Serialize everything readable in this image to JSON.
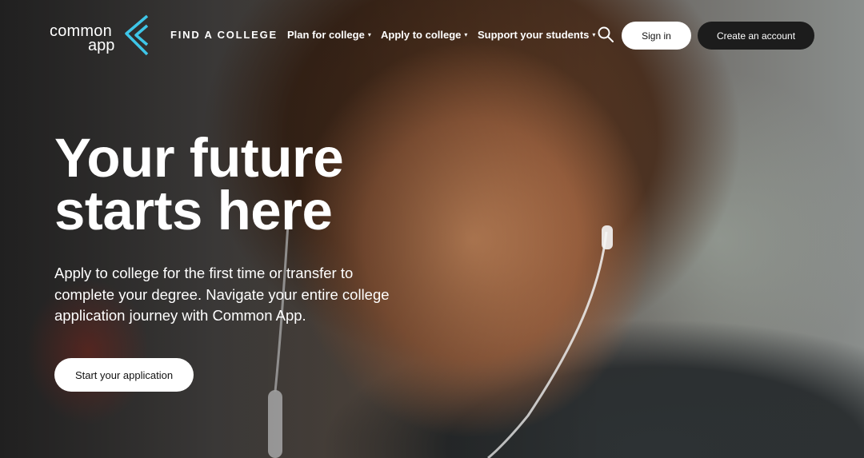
{
  "logo": {
    "line1": "common",
    "line2": "app",
    "accent": "#3ec6e8"
  },
  "nav": {
    "find": "FIND A COLLEGE",
    "items": [
      {
        "label": "Plan for college"
      },
      {
        "label": "Apply to college"
      },
      {
        "label": "Support your students"
      }
    ],
    "caret": "▾",
    "search_icon": "search-icon"
  },
  "auth": {
    "signin": "Sign in",
    "create": "Create an account"
  },
  "hero": {
    "title_line1": "Your future",
    "title_line2": "starts here",
    "description": "Apply to college for the first time or transfer to complete your degree. Navigate your entire college application journey with Common App.",
    "cta": "Start your application"
  },
  "colors": {
    "text": "#ffffff",
    "signin_bg": "#ffffff",
    "create_bg": "#1c1c1c",
    "cta_bg": "#ffffff"
  }
}
